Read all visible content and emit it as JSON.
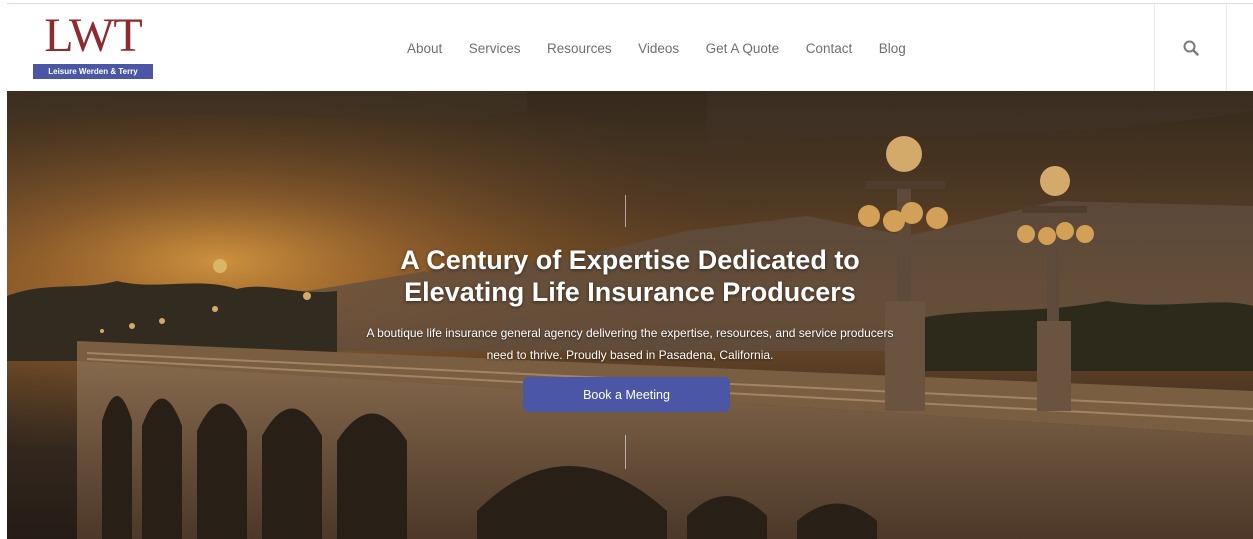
{
  "brand": {
    "logo_text": "LWT",
    "logo_subtitle": "Leisure Werden & Terry",
    "primary_color": "#8e2a32",
    "accent_color": "#4b57a6"
  },
  "nav": {
    "items": [
      "About",
      "Services",
      "Resources",
      "Videos",
      "Get A Quote",
      "Contact",
      "Blog"
    ]
  },
  "header": {
    "search_icon": "search-icon"
  },
  "hero": {
    "title_line1": "A Century of Expertise Dedicated to",
    "title_line2": "Elevating Life Insurance Producers",
    "subtitle_line1": "A boutique life insurance general agency delivering the expertise, resources, and service producers",
    "subtitle_line2": "need to thrive. Proudly based in Pasadena, California.",
    "cta_label": "Book a Meeting",
    "background": "sunset-bridge-photo"
  }
}
